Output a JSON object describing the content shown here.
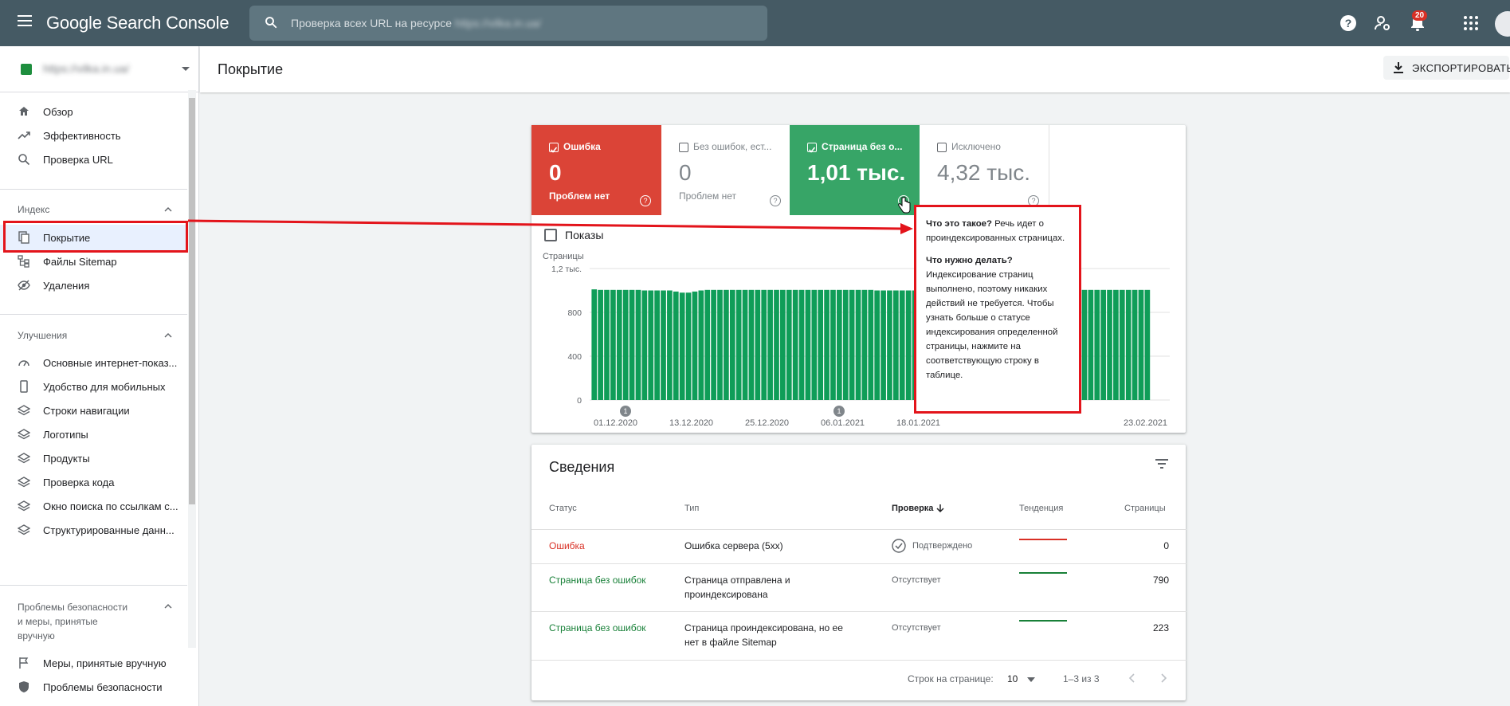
{
  "topbar": {
    "brand": "Google Search Console",
    "search_placeholder": "Проверка всех URL на ресурсе",
    "search_property": "https://vilka.in.ua/",
    "notifications_count": "20"
  },
  "sidebar": {
    "property_url": "https://vilka.in.ua/",
    "top_items": [
      {
        "label": "Обзор",
        "icon": "home-icon"
      },
      {
        "label": "Эффективность",
        "icon": "trending-up-icon"
      },
      {
        "label": "Проверка URL",
        "icon": "search-icon"
      }
    ],
    "index_section": "Индекс",
    "index_items": [
      {
        "label": "Покрытие",
        "icon": "copy-icon"
      },
      {
        "label": "Файлы Sitemap",
        "icon": "sitemap-icon"
      },
      {
        "label": "Удаления",
        "icon": "eye-off-icon"
      }
    ],
    "improvements_section": "Улучшения",
    "improvements_items": [
      {
        "label": "Основные интернет-показ...",
        "icon": "speed-icon"
      },
      {
        "label": "Удобство для мобильных",
        "icon": "phone-icon"
      },
      {
        "label": "Строки навигации",
        "icon": "layers-icon"
      },
      {
        "label": "Логотипы",
        "icon": "layers-icon"
      },
      {
        "label": "Продукты",
        "icon": "layers-icon"
      },
      {
        "label": "Проверка кода",
        "icon": "layers-icon"
      },
      {
        "label": "Окно поиска по ссылкам с...",
        "icon": "layers-icon"
      },
      {
        "label": "Структурированные данн...",
        "icon": "layers-icon"
      }
    ],
    "security_section_l1": "Проблемы безопасности",
    "security_section_l2": "и меры, принятые",
    "security_section_l3": "вручную",
    "security_items": [
      {
        "label": "Меры, принятые вручную",
        "icon": "flag-icon"
      },
      {
        "label": "Проблемы безопасности",
        "icon": "shield-icon"
      }
    ]
  },
  "header": {
    "title": "Покрытие",
    "export_label": "ЭКСПОРТИРОВАТЬ"
  },
  "tiles": [
    {
      "name": "Ошибка",
      "value": "0",
      "sub": "Проблем нет",
      "checked": true,
      "color": "#db4437"
    },
    {
      "name": "Без ошибок, ест...",
      "value": "0",
      "sub": "Проблем нет",
      "checked": false,
      "color": "#ffffff"
    },
    {
      "name": "Страница без о...",
      "value": "1,01 тыс.",
      "sub": "",
      "checked": true,
      "color": "#37a567"
    },
    {
      "name": "Исключено",
      "value": "4,32 тыс.",
      "sub": "",
      "checked": false,
      "color": "#ffffff"
    }
  ],
  "impressions_label": "Показы",
  "chart_data": {
    "type": "bar",
    "ylabel": "Страницы",
    "yticks": [
      "1,2 тыс.",
      "800",
      "400",
      "0"
    ],
    "ylim": [
      0,
      1200
    ],
    "x_tick_labels": [
      "01.12.2020",
      "13.12.2020",
      "25.12.2020",
      "06.01.2021",
      "18.01.2021",
      "23.02.2021"
    ],
    "annotations": [
      "1",
      "1"
    ],
    "series": [
      {
        "color": "#0f9d58",
        "values": [
          1010,
          1005,
          1005,
          1005,
          1005,
          1005,
          1005,
          1005,
          1000,
          1000,
          1000,
          1000,
          1000,
          990,
          980,
          980,
          990,
          1000,
          1005,
          1005,
          1005,
          1005,
          1005,
          1005,
          1005,
          1005,
          1005,
          1005,
          1005,
          1005,
          1005,
          1005,
          1005,
          1005,
          1005,
          1005,
          1005,
          1005,
          1005,
          1005,
          1005,
          1005,
          1005,
          1005,
          1005,
          1000,
          1000,
          1000,
          1000,
          1000,
          1000,
          1000,
          1000,
          1000,
          1000,
          1000,
          1000,
          1000,
          1000,
          1000,
          1000,
          1000,
          1000,
          1000,
          1000,
          1000,
          1000,
          1000,
          1005,
          1005,
          1010,
          1010,
          1005,
          1005,
          1005,
          1005,
          1005,
          1005,
          1005,
          1005,
          1005,
          1005,
          1005,
          1005,
          1005,
          1005,
          1005,
          1005,
          1005
        ]
      }
    ]
  },
  "tooltip": {
    "q1": "Что это такое?",
    "a1": "Речь идет о проиндексированных страницах.",
    "q2": "Что нужно делать?",
    "a2": "Индексирование страниц выполнено, поэтому никаких действий не требуется. Чтобы узнать больше о статусе индексирования определенной страницы, нажмите на соответствующую строку в таблице."
  },
  "details": {
    "title": "Сведения",
    "columns": [
      "Статус",
      "Тип",
      "Проверка",
      "Тенденция",
      "Страницы"
    ],
    "rows": [
      {
        "status": "Ошибка",
        "status_color": "#d93025",
        "type_l1": "Ошибка сервера (5xx)",
        "type_l2": "",
        "check": "Подтверждено",
        "trend_color": "#d93025",
        "pages": "0"
      },
      {
        "status": "Страница без ошибок",
        "status_color": "#188038",
        "type_l1": "Страница отправлена и",
        "type_l2": "проиндексирована",
        "check": "Отсутствует",
        "trend_color": "#188038",
        "pages": "790"
      },
      {
        "status": "Страница без ошибок",
        "status_color": "#188038",
        "type_l1": "Страница проиндексирована, но ее",
        "type_l2": "нет в файле Sitemap",
        "check": "Отсутствует",
        "trend_color": "#188038",
        "pages": "223"
      }
    ],
    "rows_per_page_label": "Строк на странице:",
    "rows_per_page": "10",
    "range": "1–3 из 3"
  }
}
